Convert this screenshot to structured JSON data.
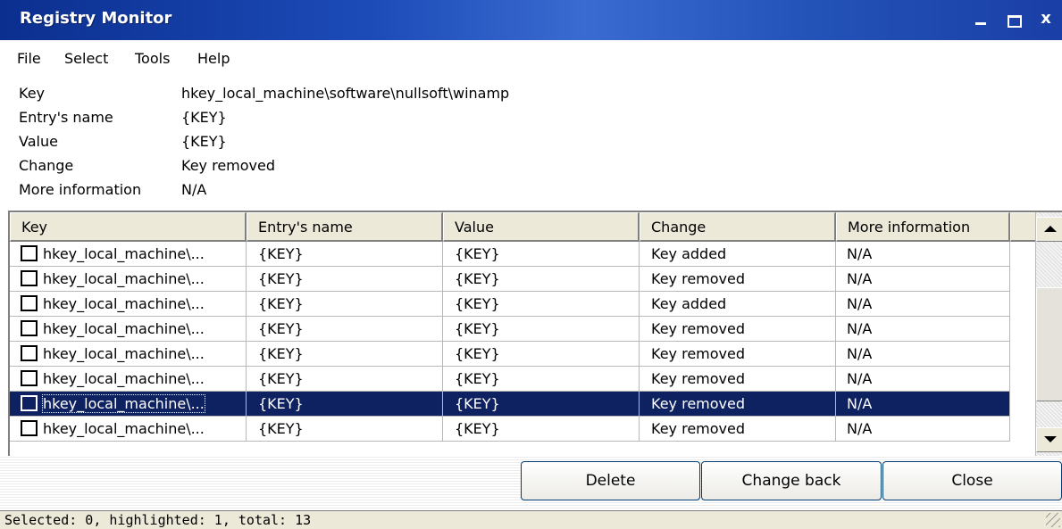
{
  "window": {
    "title": "Registry Monitor",
    "close_glyph": "x"
  },
  "menu": [
    "File",
    "Select",
    "Tools",
    "Help"
  ],
  "details": [
    {
      "label": "Key",
      "value": "hkey_local_machine\\software\\nullsoft\\winamp"
    },
    {
      "label": "Entry's name",
      "value": "{KEY}"
    },
    {
      "label": "Value",
      "value": "{KEY}"
    },
    {
      "label": "Change",
      "value": "Key removed"
    },
    {
      "label": "More information",
      "value": "N/A"
    }
  ],
  "table": {
    "columns": [
      "Key",
      "Entry's name",
      "Value",
      "Change",
      "More information"
    ],
    "rows": [
      {
        "key": "hkey_local_machine\\...",
        "entry": "{KEY}",
        "value": "{KEY}",
        "change": "Key added",
        "info": "N/A",
        "selected": false
      },
      {
        "key": "hkey_local_machine\\...",
        "entry": "{KEY}",
        "value": "{KEY}",
        "change": "Key removed",
        "info": "N/A",
        "selected": false
      },
      {
        "key": "hkey_local_machine\\...",
        "entry": "{KEY}",
        "value": "{KEY}",
        "change": "Key added",
        "info": "N/A",
        "selected": false
      },
      {
        "key": "hkey_local_machine\\...",
        "entry": "{KEY}",
        "value": "{KEY}",
        "change": "Key removed",
        "info": "N/A",
        "selected": false
      },
      {
        "key": "hkey_local_machine\\...",
        "entry": "{KEY}",
        "value": "{KEY}",
        "change": "Key removed",
        "info": "N/A",
        "selected": false
      },
      {
        "key": "hkey_local_machine\\...",
        "entry": "{KEY}",
        "value": "{KEY}",
        "change": "Key removed",
        "info": "N/A",
        "selected": false
      },
      {
        "key": "hkey_local_machine\\...",
        "entry": "{KEY}",
        "value": "{KEY}",
        "change": "Key removed",
        "info": "N/A",
        "selected": true
      },
      {
        "key": "hkey_local_machine\\...",
        "entry": "{KEY}",
        "value": "{KEY}",
        "change": "Key removed",
        "info": "N/A",
        "selected": false
      }
    ]
  },
  "buttons": {
    "delete": "Delete",
    "change_back": "Change back",
    "close": "Close"
  },
  "status": "Selected: 0, highlighted: 1, total: 13",
  "colors": {
    "titlebar": "#1c4bb8",
    "selection": "#0e2160"
  }
}
